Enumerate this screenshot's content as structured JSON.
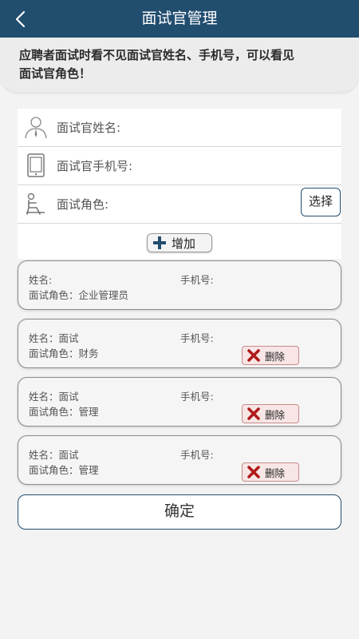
{
  "header": {
    "title": "面试官管理",
    "bg_color": "#214d6f"
  },
  "notice": {
    "text_line1": "应聘者面试时看不见面试官姓名、手机号，可以看见",
    "text_line2": "面试官角色！"
  },
  "form": {
    "name_label": "面试官姓名:",
    "phone_label": "面试官手机号:",
    "role_label": "面试角色:",
    "select_label": "选择"
  },
  "add_button": {
    "label": "增加",
    "icon": "plus-icon"
  },
  "interviewers": [
    {
      "name": "姓名:",
      "phone": "手机号:",
      "role": "面试角色：企业管理员"
    },
    {
      "name": "姓名：面试",
      "phone": "手机号:",
      "role": "面试角色：财务",
      "delete_label": "删除"
    },
    {
      "name": "姓名：面试",
      "phone": "手机号:",
      "role": "面试角色：管理",
      "delete_label": "删除"
    },
    {
      "name": "姓名：面试",
      "phone": "手机号:",
      "role": "面试角色：管理",
      "delete_label": "删除"
    }
  ],
  "confirm_label": "确定",
  "colors": {
    "accent": "#214d6f",
    "delete": "#b01a1a",
    "delete_bg": "#f8e6e6"
  }
}
